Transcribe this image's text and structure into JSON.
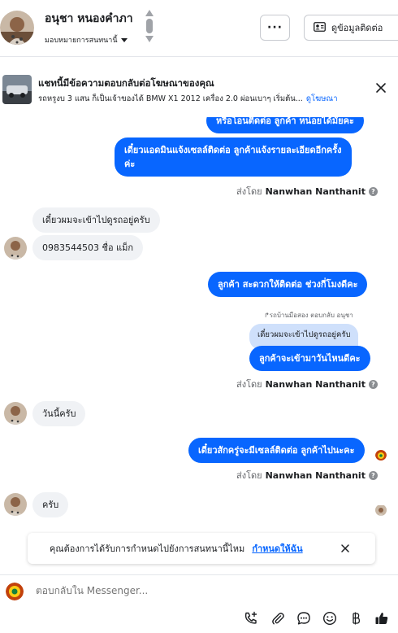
{
  "header": {
    "contact_name": "อนุชา หนองคำภา",
    "assign_label": "มอบหมายการสนทนานี้",
    "more_label": "···",
    "contact_info_label": "ดูข้อมูลติดต่อ"
  },
  "ad_banner": {
    "title": "แชทนี้มีข้อความตอบกลับต่อโฆษณาของคุณ",
    "description": "รถหรูงบ 3 แสน ก็เป็นเจ้าของได้ BMW X1 2012 เครื่อง 2.0 ผ่อนเบาๆ เริ่มต้น...",
    "link_label": "ดูโฆษณา"
  },
  "messages": [
    {
      "id": "m1",
      "from": "page",
      "text": "หรือโอนติดต่อ ลูกค้า หน่อยได้มั้ยคะ"
    },
    {
      "id": "m2",
      "from": "page",
      "lines": [
        "เดี๋ยวแอดมินแจ้งเซลล์ติดต่อ ลูกค้าแจ้งรายละเอียดอีกครั้ง",
        "ค่ะ"
      ]
    },
    {
      "id": "m3",
      "from": "customer",
      "text": "เดี๋ยวผมจะเข้าไปดูรถอยู่ครับ"
    },
    {
      "id": "m4",
      "from": "customer",
      "text": "0983544503 ชื่อ แม็ก"
    },
    {
      "id": "m5",
      "from": "page",
      "text": "ลูกค้า สะดวกให้ติดต่อ ช่วงกี่โมงดีคะ"
    },
    {
      "id": "m6",
      "from": "page",
      "reply_label": "รถบ้านมือสอง ตอบกลับ อนุชา",
      "quoted": "เดี๋ยวผมจะเข้าไปดูรถอยู่ครับ",
      "text": "ลูกค้าจะเข้ามาวันไหนดีคะ"
    },
    {
      "id": "m7",
      "from": "customer",
      "text": "วันนี้ครับ"
    },
    {
      "id": "m8",
      "from": "page",
      "text": "เดี๋ยวสักครู่จะมีเซลล์ติดต่อ ลูกค้าไปนะคะ"
    },
    {
      "id": "m9",
      "from": "customer",
      "text": "ครับ"
    }
  ],
  "sent_by": {
    "prefix": "ส่งโดย",
    "name": "Nanwhan Nanthanit"
  },
  "notification": {
    "text": "คุณต้องการได้รับการกำหนดไปยังการสนทนานี้ไหม",
    "action_label": "กำหนดให้ฉัน"
  },
  "composer": {
    "placeholder": "ตอบกลับใน Messenger..."
  },
  "colors": {
    "accent": "#0866ff",
    "incoming_bubble": "#f0f2f5",
    "quoted_bubble": "#cfe0fb"
  }
}
